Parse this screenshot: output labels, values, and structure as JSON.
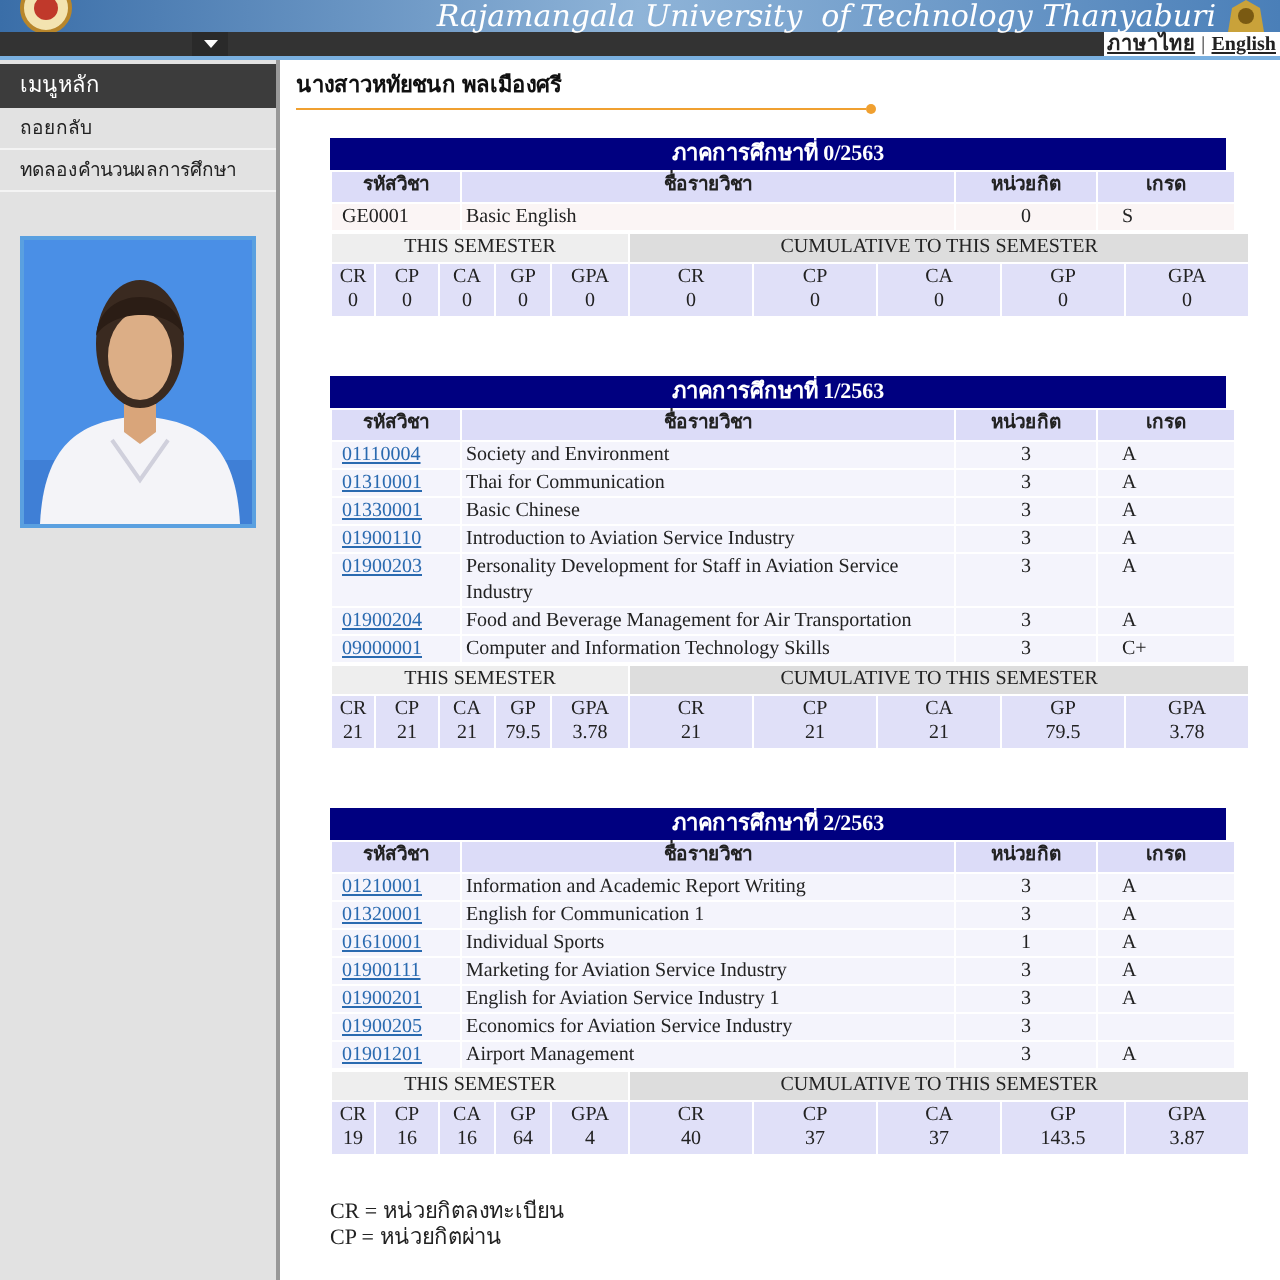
{
  "banner": {
    "title": "Rajamangala University  of Technology Thanyaburi"
  },
  "language_links": [
    "ภาษาไทย",
    "|",
    "English"
  ],
  "sidebar": {
    "title": "เมนูหลัก",
    "items": [
      "ถอยกลับ",
      "ทดลองคำนวนผลการศึกษา"
    ],
    "photo": {
      "kind": "picture"
    }
  },
  "student_name": "นางสาวหทัยชนก พลเมืองศรี",
  "semesters": [
    {
      "title": "ภาคการศึกษาที่ 0/2563",
      "columns": [
        "รหัสวิชา",
        "ชื่อรายวิชา",
        "หน่วยกิต",
        "เกรด"
      ],
      "courses": [
        {
          "code": "GE0001",
          "link": false,
          "name": "Basic English",
          "credits": "0",
          "grade": "S"
        }
      ],
      "this_semester_label": "THIS SEMESTER",
      "cumulative_label": "CUMULATIVE TO THIS SEMESTER",
      "this_semester": [
        {
          "label": "CR",
          "value": "0"
        },
        {
          "label": "CP",
          "value": "0"
        },
        {
          "label": "CA",
          "value": "0"
        },
        {
          "label": "GP",
          "value": "0"
        },
        {
          "label": "GPA",
          "value": "0"
        }
      ],
      "cumulative": [
        {
          "label": "CR",
          "value": "0"
        },
        {
          "label": "CP",
          "value": "0"
        },
        {
          "label": "CA",
          "value": "0"
        },
        {
          "label": "GP",
          "value": "0"
        },
        {
          "label": "GPA",
          "value": "0"
        }
      ]
    },
    {
      "title": "ภาคการศึกษาที่ 1/2563",
      "columns": [
        "รหัสวิชา",
        "ชื่อรายวิชา",
        "หน่วยกิต",
        "เกรด"
      ],
      "courses": [
        {
          "code": "01110004",
          "link": true,
          "name": "Society and Environment",
          "credits": "3",
          "grade": "A"
        },
        {
          "code": "01310001",
          "link": true,
          "name": "Thai for Communication",
          "credits": "3",
          "grade": "A"
        },
        {
          "code": "01330001",
          "link": true,
          "name": "Basic Chinese",
          "credits": "3",
          "grade": "A"
        },
        {
          "code": "01900110",
          "link": true,
          "name": "Introduction to Aviation Service Industry",
          "credits": "3",
          "grade": "A"
        },
        {
          "code": "01900203",
          "link": true,
          "name": "Personality Development for Staff in Aviation Service Industry",
          "credits": "3",
          "grade": "A"
        },
        {
          "code": "01900204",
          "link": true,
          "name": "Food and Beverage Management for Air Transportation",
          "credits": "3",
          "grade": "A"
        },
        {
          "code": "09000001",
          "link": true,
          "name": "Computer and Information Technology Skills",
          "credits": "3",
          "grade": "C+"
        }
      ],
      "this_semester_label": "THIS SEMESTER",
      "cumulative_label": "CUMULATIVE TO THIS SEMESTER",
      "this_semester": [
        {
          "label": "CR",
          "value": "21"
        },
        {
          "label": "CP",
          "value": "21"
        },
        {
          "label": "CA",
          "value": "21"
        },
        {
          "label": "GP",
          "value": "79.5"
        },
        {
          "label": "GPA",
          "value": "3.78"
        }
      ],
      "cumulative": [
        {
          "label": "CR",
          "value": "21"
        },
        {
          "label": "CP",
          "value": "21"
        },
        {
          "label": "CA",
          "value": "21"
        },
        {
          "label": "GP",
          "value": "79.5"
        },
        {
          "label": "GPA",
          "value": "3.78"
        }
      ]
    },
    {
      "title": "ภาคการศึกษาที่ 2/2563",
      "columns": [
        "รหัสวิชา",
        "ชื่อรายวิชา",
        "หน่วยกิต",
        "เกรด"
      ],
      "courses": [
        {
          "code": "01210001",
          "link": true,
          "name": "Information and Academic Report Writing",
          "credits": "3",
          "grade": "A"
        },
        {
          "code": "01320001",
          "link": true,
          "name": "English for Communication 1",
          "credits": "3",
          "grade": "A"
        },
        {
          "code": "01610001",
          "link": true,
          "name": "Individual Sports",
          "credits": "1",
          "grade": "A"
        },
        {
          "code": "01900111",
          "link": true,
          "name": "Marketing for Aviation Service Industry",
          "credits": "3",
          "grade": "A"
        },
        {
          "code": "01900201",
          "link": true,
          "name": "English for Aviation Service Industry 1",
          "credits": "3",
          "grade": "A"
        },
        {
          "code": "01900205",
          "link": true,
          "name": "Economics for Aviation Service Industry",
          "credits": "3"
        },
        {
          "code": "01901201",
          "link": true,
          "name": "Airport Management",
          "credits": "3",
          "grade": "A"
        }
      ],
      "this_semester_label": "THIS SEMESTER",
      "cumulative_label": "CUMULATIVE TO THIS SEMESTER",
      "this_semester": [
        {
          "label": "CR",
          "value": "19"
        },
        {
          "label": "CP",
          "value": "16"
        },
        {
          "label": "CA",
          "value": "16"
        },
        {
          "label": "GP",
          "value": "64"
        },
        {
          "label": "GPA",
          "value": "4"
        }
      ],
      "cumulative": [
        {
          "label": "CR",
          "value": "40"
        },
        {
          "label": "CP",
          "value": "37"
        },
        {
          "label": "CA",
          "value": "37"
        },
        {
          "label": "GP",
          "value": "143.5"
        },
        {
          "label": "GPA",
          "value": "3.87"
        }
      ]
    }
  ],
  "legend": [
    "CR = หน่วยกิตลงทะเบียน",
    "CP = หน่วยกิตผ่าน"
  ]
}
